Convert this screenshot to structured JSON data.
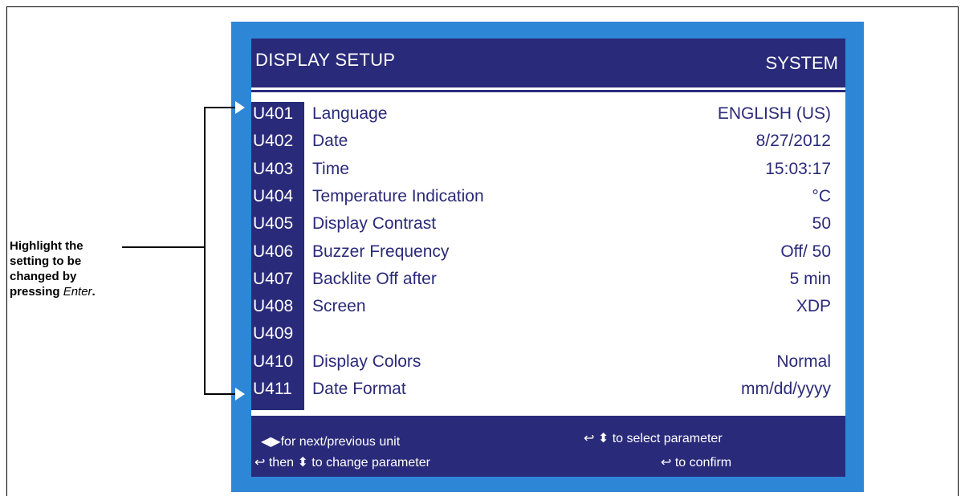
{
  "screen": {
    "title": "DISPLAY SETUP",
    "mode": "SYSTEM"
  },
  "rows": [
    {
      "code": "U401",
      "label": "Language",
      "value": "ENGLISH (US)"
    },
    {
      "code": "U402",
      "label": "Date",
      "value": "8/27/2012"
    },
    {
      "code": "U403",
      "label": "Time",
      "value": "15:03:17"
    },
    {
      "code": "U404",
      "label": "Temperature Indication",
      "value": "°C"
    },
    {
      "code": "U405",
      "label": "Display Contrast",
      "value": "50"
    },
    {
      "code": "U406",
      "label": "Buzzer Frequency",
      "value": "Off/ 50"
    },
    {
      "code": "U407",
      "label": "Backlite Off after",
      "value": "5 min"
    },
    {
      "code": "U408",
      "label": "Screen",
      "value": "XDP"
    },
    {
      "code": "U409",
      "label": "",
      "value": ""
    },
    {
      "code": "U410",
      "label": "Display Colors",
      "value": "Normal"
    },
    {
      "code": "U411",
      "label": "Date Format",
      "value": "mm/dd/yyyy"
    }
  ],
  "footer": {
    "left_line1": "◀▶for next/previous unit",
    "left_line2": "↩ then ⬍  to change parameter",
    "right_line1": "↩ ⬍ to select parameter",
    "right_line2": "↩  to confirm"
  },
  "callout": {
    "line1": "Highlight the",
    "line2": "setting to be",
    "line3": "changed by",
    "line4_prefix": "pressing ",
    "line4_emph": "Enter",
    "line4_suffix": "."
  },
  "colors": {
    "device_bezel": "#2e86d6",
    "screen_dark": "#2a2a7a",
    "screen_text": "#ffffff",
    "content_bg": "#ffffff"
  }
}
